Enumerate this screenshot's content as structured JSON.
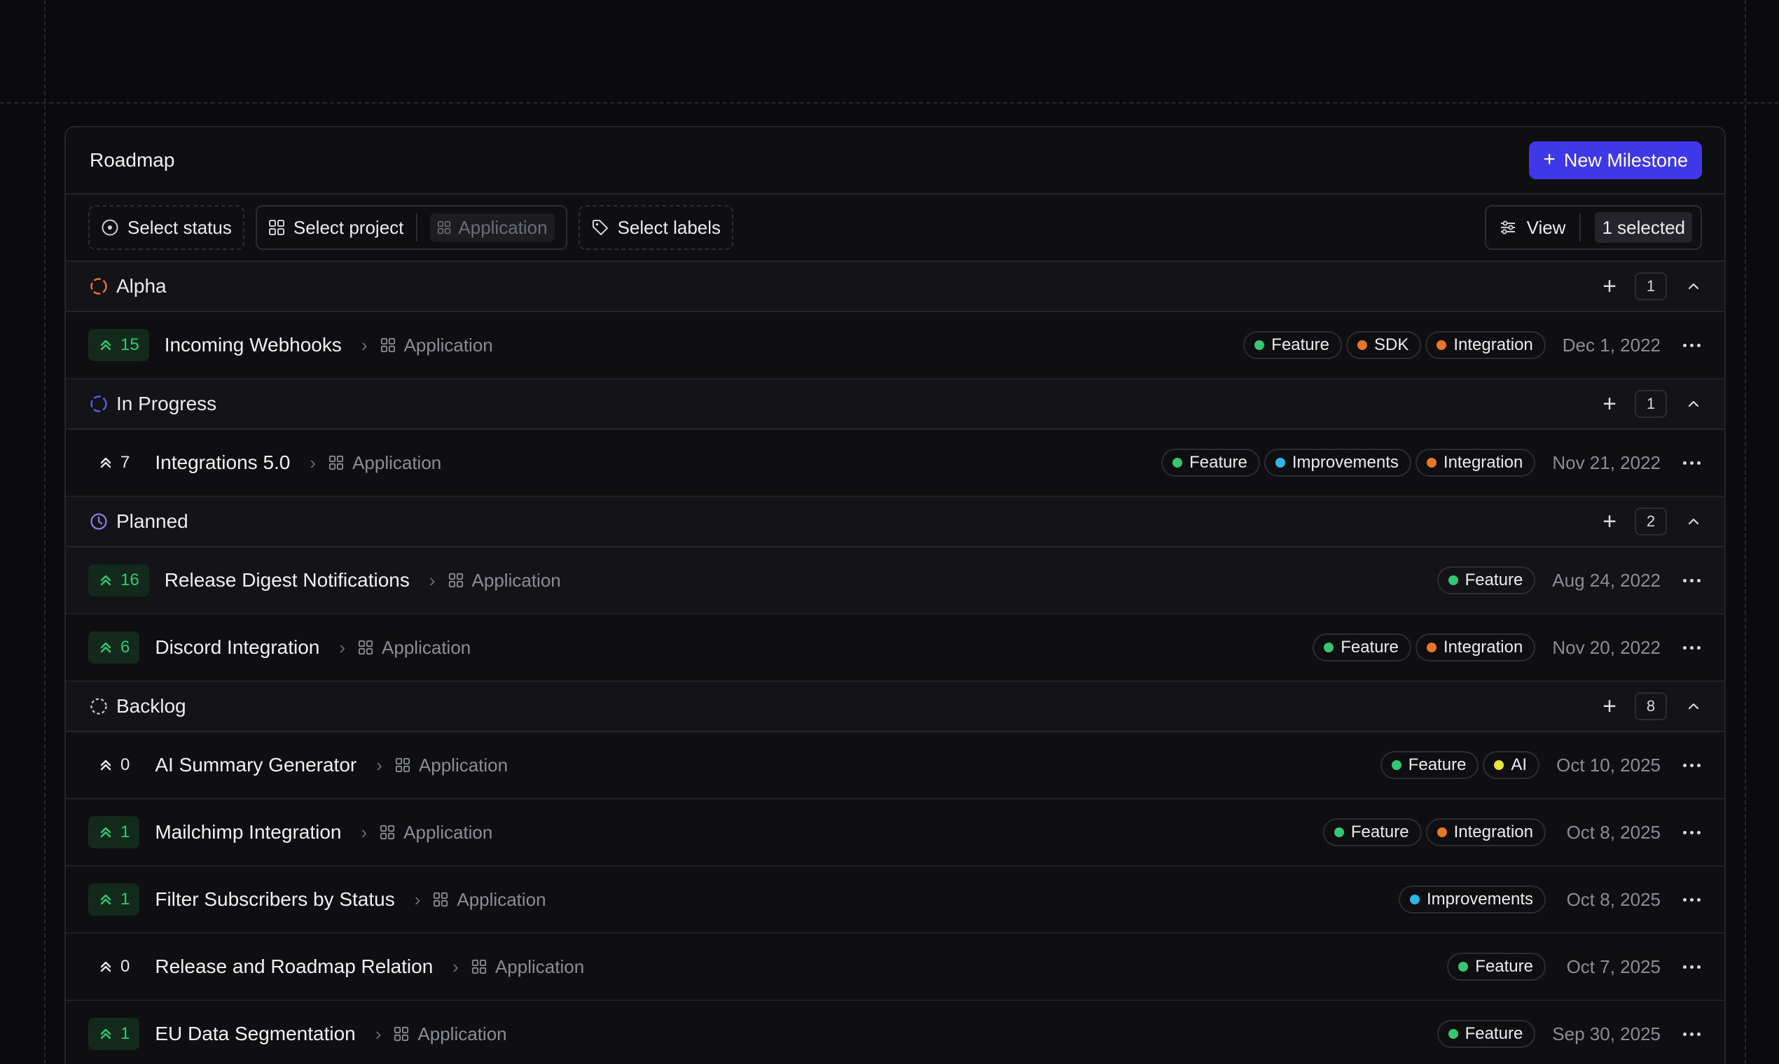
{
  "panel": {
    "title": "Roadmap",
    "new_button": "New Milestone"
  },
  "filters": {
    "status": "Select status",
    "project": "Select project",
    "project_value": "Application",
    "labels": "Select labels",
    "view": "View",
    "selected": "1 selected"
  },
  "colors": {
    "accent": "#3f38e8",
    "feature": "#36c772",
    "sdk": "#e5762a",
    "integration": "#e5762a",
    "improvements": "#2ab6e6",
    "ai": "#e8e53a"
  },
  "groups": [
    {
      "name": "Alpha",
      "count": "1",
      "status_icon": "alpha-status-icon",
      "rows": [
        {
          "priority": "15",
          "priority_style": "green",
          "title": "Incoming Webhooks",
          "project": "Application",
          "tags": [
            {
              "label": "Feature",
              "color": "#36c772"
            },
            {
              "label": "SDK",
              "color": "#e5762a"
            },
            {
              "label": "Integration",
              "color": "#e5762a"
            }
          ],
          "date": "Dec 1, 2022"
        }
      ]
    },
    {
      "name": "In Progress",
      "count": "1",
      "status_icon": "in-progress-status-icon",
      "rows": [
        {
          "priority": "7",
          "priority_style": "plain",
          "title": "Integrations 5.0",
          "project": "Application",
          "tags": [
            {
              "label": "Feature",
              "color": "#36c772"
            },
            {
              "label": "Improvements",
              "color": "#2ab6e6"
            },
            {
              "label": "Integration",
              "color": "#e5762a"
            }
          ],
          "date": "Nov 21, 2022"
        }
      ]
    },
    {
      "name": "Planned",
      "count": "2",
      "status_icon": "planned-clock-icon",
      "rows": [
        {
          "priority": "16",
          "priority_style": "green",
          "title": "Release Digest Notifications",
          "project": "Application",
          "tags": [
            {
              "label": "Feature",
              "color": "#36c772"
            }
          ],
          "date": "Aug 24, 2022",
          "highlight": true
        },
        {
          "priority": "6",
          "priority_style": "green",
          "title": "Discord Integration",
          "project": "Application",
          "tags": [
            {
              "label": "Feature",
              "color": "#36c772"
            },
            {
              "label": "Integration",
              "color": "#e5762a"
            }
          ],
          "date": "Nov 20, 2022"
        }
      ]
    },
    {
      "name": "Backlog",
      "count": "8",
      "status_icon": "backlog-status-icon",
      "rows": [
        {
          "priority": "0",
          "priority_style": "plain",
          "title": "AI Summary Generator",
          "project": "Application",
          "tags": [
            {
              "label": "Feature",
              "color": "#36c772"
            },
            {
              "label": "AI",
              "color": "#e8e53a"
            }
          ],
          "date": "Oct 10, 2025"
        },
        {
          "priority": "1",
          "priority_style": "green",
          "title": "Mailchimp Integration",
          "project": "Application",
          "tags": [
            {
              "label": "Feature",
              "color": "#36c772"
            },
            {
              "label": "Integration",
              "color": "#e5762a"
            }
          ],
          "date": "Oct 8, 2025"
        },
        {
          "priority": "1",
          "priority_style": "green",
          "title": "Filter Subscribers by Status",
          "project": "Application",
          "tags": [
            {
              "label": "Improvements",
              "color": "#2ab6e6"
            }
          ],
          "date": "Oct 8, 2025"
        },
        {
          "priority": "0",
          "priority_style": "plain",
          "title": "Release and Roadmap Relation",
          "project": "Application",
          "tags": [
            {
              "label": "Feature",
              "color": "#36c772"
            }
          ],
          "date": "Oct 7, 2025"
        },
        {
          "priority": "1",
          "priority_style": "green",
          "title": "EU Data Segmentation",
          "project": "Application",
          "tags": [
            {
              "label": "Feature",
              "color": "#36c772"
            }
          ],
          "date": "Sep 30, 2025"
        }
      ]
    }
  ]
}
